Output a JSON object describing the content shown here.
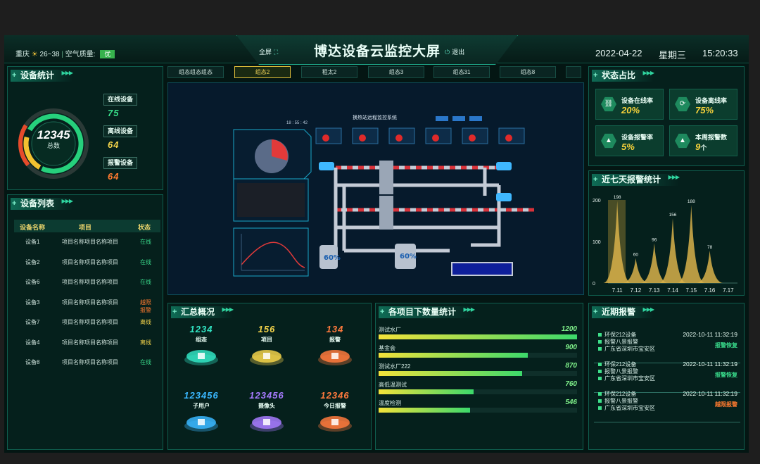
{
  "header": {
    "city": "重庆",
    "weather_icon": "sun-icon",
    "temp": "26~38",
    "air_label": "空气质量:",
    "air_value": "优",
    "fullscreen": "全屏",
    "title": "博达设备云监控大屏",
    "exit": "退出",
    "date": "2022-04-22",
    "weekday": "星期三",
    "time": "15:20:33"
  },
  "tabs": [
    "组态组态组态",
    "组态2",
    "租太2",
    "组态3",
    "组态31",
    "组态8"
  ],
  "device_stats": {
    "title": "设备统计",
    "total_value": "12345",
    "total_label": "总数",
    "online_label": "在线设备",
    "online_value": "75",
    "offline_label": "离线设备",
    "offline_value": "64",
    "alarm_label": "报警设备",
    "alarm_value": "64"
  },
  "device_list": {
    "title": "设备列表",
    "columns": [
      "设备名称",
      "项目",
      "状态"
    ],
    "rows": [
      {
        "name": "设备1",
        "project": "项目名称项目名称项目",
        "status": "在线",
        "color": "#39d98a"
      },
      {
        "name": "设备2",
        "project": "项目名称项目名称项目",
        "status": "在线",
        "color": "#39d98a"
      },
      {
        "name": "设备6",
        "project": "项目名称项目名称项目",
        "status": "在线",
        "color": "#39d98a"
      },
      {
        "name": "设备3",
        "project": "项目名称项目名称项目",
        "status": "越限报警",
        "color": "#ff7a2f"
      },
      {
        "name": "设备7",
        "project": "项目名称项目名称项目",
        "status": "离线",
        "color": "#f2d24a"
      },
      {
        "name": "设备4",
        "project": "项目名称项目名称项目",
        "status": "离线",
        "color": "#f2d24a"
      },
      {
        "name": "设备8",
        "project": "项目名称项目名称项目",
        "status": "在线",
        "color": "#39d98a"
      }
    ]
  },
  "scada": {
    "title": "换热站远程监控系统",
    "clock": "18 : 55 : 42"
  },
  "status_ratio": {
    "title": "状态占比",
    "tiles": [
      {
        "label": "设备在线率",
        "value": "20%",
        "unit": "",
        "icon": "link-icon"
      },
      {
        "label": "设备离线率",
        "value": "75%",
        "unit": "",
        "icon": "unlink-icon"
      },
      {
        "label": "设备报警率",
        "value": "5%",
        "unit": "",
        "icon": "alarm-icon"
      },
      {
        "label": "本周报警数",
        "value": "9",
        "unit": "个",
        "icon": "bell-icon"
      }
    ]
  },
  "alarm_chart": {
    "title": "近七天报警统计"
  },
  "chart_data": {
    "type": "area",
    "title": "近七天报警统计",
    "categories": [
      "7.11",
      "7.12",
      "7.13",
      "7.14",
      "7.15",
      "7.16",
      "7.17"
    ],
    "values": [
      198,
      60,
      96,
      156,
      188,
      78,
      0
    ],
    "peak_labels": [
      "198",
      "60",
      "96",
      "156",
      "188",
      "78"
    ],
    "yticks": [
      "200",
      "100",
      "0"
    ],
    "ylim": [
      0,
      200
    ]
  },
  "summary": {
    "title": "汇总概况",
    "items": [
      {
        "value": "1234",
        "label": "组态",
        "color": "#31e3c2",
        "icon": "grid-icon"
      },
      {
        "value": "156",
        "label": "项目",
        "color": "#f2d24a",
        "icon": "list-icon"
      },
      {
        "value": "134",
        "label": "报警",
        "color": "#ff7a3d",
        "icon": "warning-icon"
      },
      {
        "value": "123456",
        "label": "子用户",
        "color": "#3ab7ff",
        "icon": "user-icon"
      },
      {
        "value": "123456",
        "label": "摄像头",
        "color": "#a77bff",
        "icon": "camera-icon"
      },
      {
        "value": "12346",
        "label": "今日报警",
        "color": "#ff7a3d",
        "icon": "calendar-icon"
      }
    ]
  },
  "project_counts": {
    "title": "各项目下数量统计",
    "items": [
      {
        "name": "测试水厂",
        "value": "1200",
        "fraction": 1.0
      },
      {
        "name": "基金会",
        "value": "900",
        "fraction": 0.75
      },
      {
        "name": "测试水厂222",
        "value": "870",
        "fraction": 0.725
      },
      {
        "name": "高低温测试",
        "value": "760",
        "fraction": 0.48
      },
      {
        "name": "温度检测",
        "value": "546",
        "fraction": 0.46
      }
    ]
  },
  "recent_alarms": {
    "title": "近期报警",
    "items": [
      {
        "device": "环保212设备",
        "type": "报警八景报警",
        "location": "广东省深圳市宝安区",
        "time": "2022-10-11  11:32:19",
        "status": "报警恢复",
        "color": "#39d98a"
      },
      {
        "device": "环保212设备",
        "type": "报警八景报警",
        "location": "广东省深圳市宝安区",
        "time": "2022-10-11  11:32:19",
        "status": "报警恢复",
        "color": "#39d98a"
      },
      {
        "device": "环保212设备",
        "type": "报警八景报警",
        "location": "广东省深圳市宝安区",
        "time": "2022-10-11  11:32:19",
        "status": "越限报警",
        "color": "#ff7a2f"
      }
    ]
  }
}
